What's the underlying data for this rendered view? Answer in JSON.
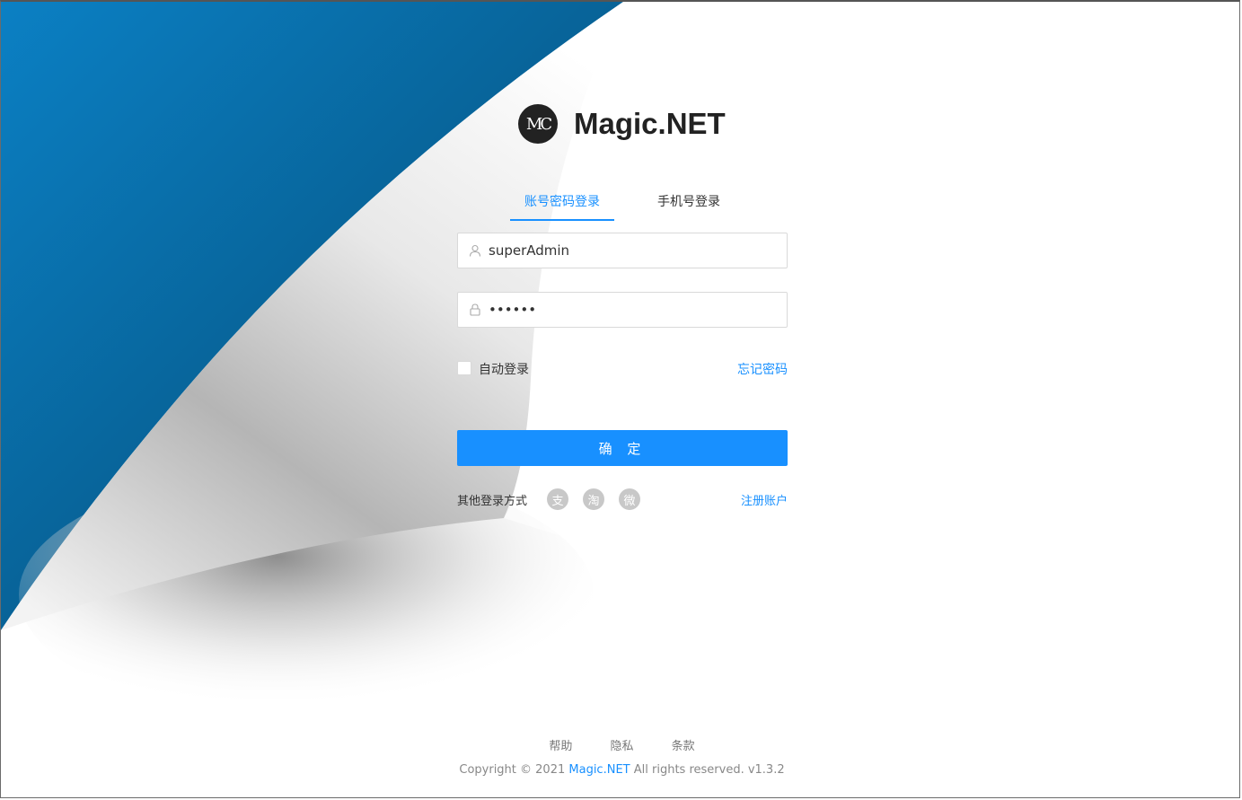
{
  "brand": {
    "name": "Magic.NET",
    "logo_text": "MC"
  },
  "tabs": [
    {
      "label": "账号密码登录",
      "active": true
    },
    {
      "label": "手机号登录",
      "active": false
    }
  ],
  "username": {
    "value": "superAdmin",
    "icon": "user-icon"
  },
  "password": {
    "value": "••••••",
    "icon": "lock-icon"
  },
  "options": {
    "auto_login_label": "自动登录",
    "auto_login_checked": false,
    "forgot_label": "忘记密码"
  },
  "submit_label": "确 定",
  "other_login": {
    "label": "其他登录方式",
    "providers": [
      {
        "name": "alipay-icon",
        "glyph": "支"
      },
      {
        "name": "taobao-icon",
        "glyph": "淘"
      },
      {
        "name": "weibo-icon",
        "glyph": "微"
      }
    ],
    "register_label": "注册账户"
  },
  "footer": {
    "links": [
      "帮助",
      "隐私",
      "条款"
    ],
    "copyright_prefix": "Copyright © 2021",
    "copyright_brand": "Magic.NET",
    "copyright_suffix": "All rights reserved. v1.3.2"
  },
  "colors": {
    "primary": "#1890ff",
    "page_curl_blue": "#0a6aa8"
  }
}
